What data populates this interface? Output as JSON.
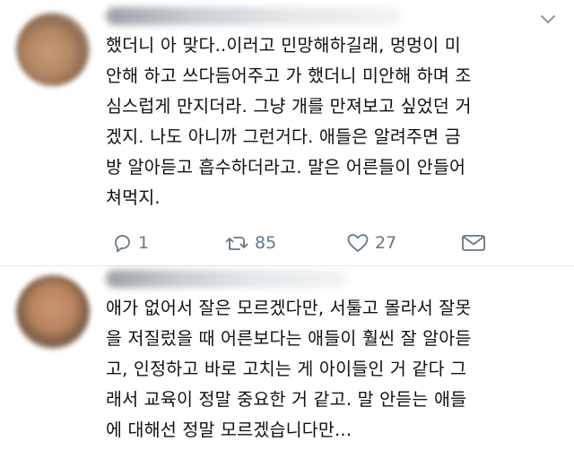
{
  "tweets": [
    {
      "lines": [
        "했더니 아 맞다..이러고 민망해하길래, 멍멍이 미",
        "안해 하고 쓰다듬어주고 가 했더니 미안해 하며 조",
        "심스럽게 만지더라. 그냥 개를 만져보고 싶었던 거",
        "겠지. 나도 아니까 그런거다. 애들은 알려주면 금",
        "방 알아듣고 흡수하더라고. 말은 어른들이 안들어",
        "쳐먹지."
      ],
      "actions": {
        "reply_count": "1",
        "retweet_count": "85",
        "like_count": "27"
      }
    },
    {
      "lines": [
        "애가 없어서 잘은 모르겠다만, 서툴고 몰라서 잘못",
        "을 저질렀을 때 어른보다는 애들이 훨씬 잘 알아듣",
        "고, 인정하고 바로 고치는 게 아이들인 거 같다 그",
        "래서 교육이 정말 중요한 거 같고. 말 안듣는 애들",
        "에 대해선 정말 모르겠습니다만..."
      ]
    }
  ],
  "icons": {
    "reply": "reply-icon",
    "retweet": "retweet-icon",
    "like": "heart-icon",
    "dm": "envelope-icon",
    "more": "chevron-down-icon"
  },
  "colors": {
    "text": "#111111",
    "action_gray": "#657786",
    "divider": "#e6ecf0"
  }
}
